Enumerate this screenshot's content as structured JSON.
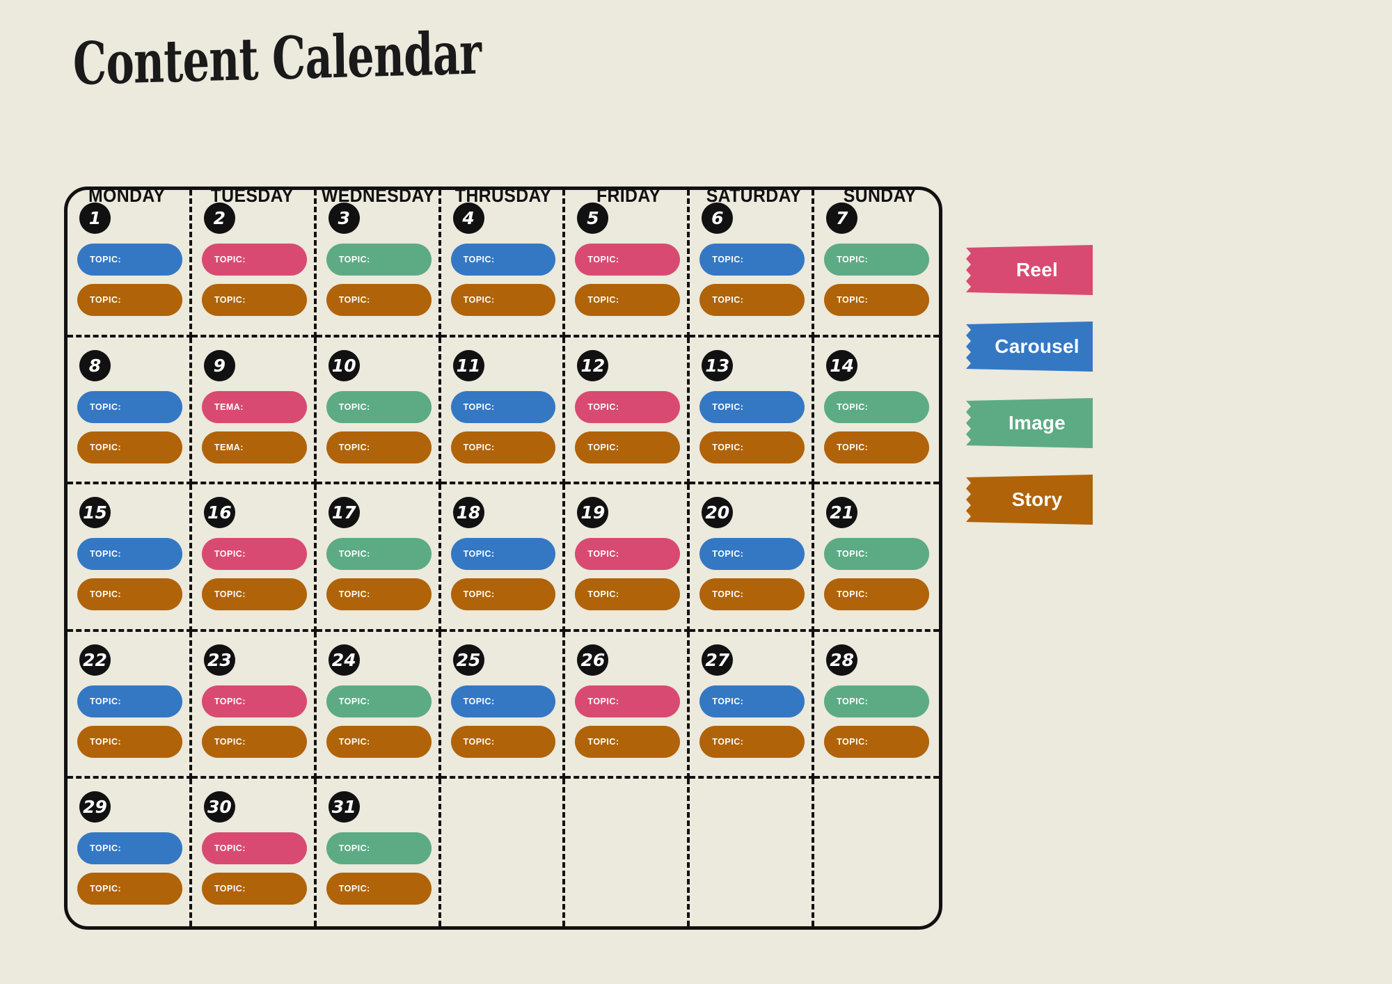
{
  "page": {
    "title": "Content Calendar",
    "background_color": "#ece9dd"
  },
  "weekdays": [
    "MONDAY",
    "TUESDAY",
    "WEDNESDAY",
    "THRUSDAY",
    "FRIDAY",
    "SATURDAY",
    "SUNDAY"
  ],
  "legend": {
    "items": [
      {
        "label": "Reel",
        "color": "#d94a72",
        "type": "reel"
      },
      {
        "label": "Carousel",
        "color": "#3478c4",
        "type": "carousel"
      },
      {
        "label": "Image",
        "color": "#5cab85",
        "type": "image"
      },
      {
        "label": "Story",
        "color": "#b06308",
        "type": "story"
      }
    ]
  },
  "calendar": {
    "weeks": [
      [
        {
          "day": "1",
          "pills": [
            {
              "label": "TOPIC:",
              "type": "carousel"
            },
            {
              "label": "TOPIC:",
              "type": "story"
            }
          ]
        },
        {
          "day": "2",
          "pills": [
            {
              "label": "TOPIC:",
              "type": "reel"
            },
            {
              "label": "TOPIC:",
              "type": "story"
            }
          ]
        },
        {
          "day": "3",
          "pills": [
            {
              "label": "TOPIC:",
              "type": "image"
            },
            {
              "label": "TOPIC:",
              "type": "story"
            }
          ]
        },
        {
          "day": "4",
          "pills": [
            {
              "label": "TOPIC:",
              "type": "carousel"
            },
            {
              "label": "TOPIC:",
              "type": "story"
            }
          ]
        },
        {
          "day": "5",
          "pills": [
            {
              "label": "TOPIC:",
              "type": "reel"
            },
            {
              "label": "TOPIC:",
              "type": "story"
            }
          ]
        },
        {
          "day": "6",
          "pills": [
            {
              "label": "TOPIC:",
              "type": "carousel"
            },
            {
              "label": "TOPIC:",
              "type": "story"
            }
          ]
        },
        {
          "day": "7",
          "pills": [
            {
              "label": "TOPIC:",
              "type": "image"
            },
            {
              "label": "TOPIC:",
              "type": "story"
            }
          ]
        }
      ],
      [
        {
          "day": "8",
          "pills": [
            {
              "label": "TOPIC:",
              "type": "carousel"
            },
            {
              "label": "TOPIC:",
              "type": "story"
            }
          ]
        },
        {
          "day": "9",
          "pills": [
            {
              "label": "TEMA:",
              "type": "reel"
            },
            {
              "label": "TEMA:",
              "type": "story"
            }
          ]
        },
        {
          "day": "10",
          "pills": [
            {
              "label": "TOPIC:",
              "type": "image"
            },
            {
              "label": "TOPIC:",
              "type": "story"
            }
          ]
        },
        {
          "day": "11",
          "pills": [
            {
              "label": "TOPIC:",
              "type": "carousel"
            },
            {
              "label": "TOPIC:",
              "type": "story"
            }
          ]
        },
        {
          "day": "12",
          "pills": [
            {
              "label": "TOPIC:",
              "type": "reel"
            },
            {
              "label": "TOPIC:",
              "type": "story"
            }
          ]
        },
        {
          "day": "13",
          "pills": [
            {
              "label": "TOPIC:",
              "type": "carousel"
            },
            {
              "label": "TOPIC:",
              "type": "story"
            }
          ]
        },
        {
          "day": "14",
          "pills": [
            {
              "label": "TOPIC:",
              "type": "image"
            },
            {
              "label": "TOPIC:",
              "type": "story"
            }
          ]
        }
      ],
      [
        {
          "day": "15",
          "pills": [
            {
              "label": "TOPIC:",
              "type": "carousel"
            },
            {
              "label": "TOPIC:",
              "type": "story"
            }
          ]
        },
        {
          "day": "16",
          "pills": [
            {
              "label": "TOPIC:",
              "type": "reel"
            },
            {
              "label": "TOPIC:",
              "type": "story"
            }
          ]
        },
        {
          "day": "17",
          "pills": [
            {
              "label": "TOPIC:",
              "type": "image"
            },
            {
              "label": "TOPIC:",
              "type": "story"
            }
          ]
        },
        {
          "day": "18",
          "pills": [
            {
              "label": "TOPIC:",
              "type": "carousel"
            },
            {
              "label": "TOPIC:",
              "type": "story"
            }
          ]
        },
        {
          "day": "19",
          "pills": [
            {
              "label": "TOPIC:",
              "type": "reel"
            },
            {
              "label": "TOPIC:",
              "type": "story"
            }
          ]
        },
        {
          "day": "20",
          "pills": [
            {
              "label": "TOPIC:",
              "type": "carousel"
            },
            {
              "label": "TOPIC:",
              "type": "story"
            }
          ]
        },
        {
          "day": "21",
          "pills": [
            {
              "label": "TOPIC:",
              "type": "image"
            },
            {
              "label": "TOPIC:",
              "type": "story"
            }
          ]
        }
      ],
      [
        {
          "day": "22",
          "pills": [
            {
              "label": "TOPIC:",
              "type": "carousel"
            },
            {
              "label": "TOPIC:",
              "type": "story"
            }
          ]
        },
        {
          "day": "23",
          "pills": [
            {
              "label": "TOPIC:",
              "type": "reel"
            },
            {
              "label": "TOPIC:",
              "type": "story"
            }
          ]
        },
        {
          "day": "24",
          "pills": [
            {
              "label": "TOPIC:",
              "type": "image"
            },
            {
              "label": "TOPIC:",
              "type": "story"
            }
          ]
        },
        {
          "day": "25",
          "pills": [
            {
              "label": "TOPIC:",
              "type": "carousel"
            },
            {
              "label": "TOPIC:",
              "type": "story"
            }
          ]
        },
        {
          "day": "26",
          "pills": [
            {
              "label": "TOPIC:",
              "type": "reel"
            },
            {
              "label": "TOPIC:",
              "type": "story"
            }
          ]
        },
        {
          "day": "27",
          "pills": [
            {
              "label": "TOPIC:",
              "type": "carousel"
            },
            {
              "label": "TOPIC:",
              "type": "story"
            }
          ]
        },
        {
          "day": "28",
          "pills": [
            {
              "label": "TOPIC:",
              "type": "image"
            },
            {
              "label": "TOPIC:",
              "type": "story"
            }
          ]
        }
      ],
      [
        {
          "day": "29",
          "pills": [
            {
              "label": "TOPIC:",
              "type": "carousel"
            },
            {
              "label": "TOPIC:",
              "type": "story"
            }
          ]
        },
        {
          "day": "30",
          "pills": [
            {
              "label": "TOPIC:",
              "type": "reel"
            },
            {
              "label": "TOPIC:",
              "type": "story"
            }
          ]
        },
        {
          "day": "31",
          "pills": [
            {
              "label": "TOPIC:",
              "type": "image"
            },
            {
              "label": "TOPIC:",
              "type": "story"
            }
          ]
        },
        {
          "day": "",
          "pills": []
        },
        {
          "day": "",
          "pills": []
        },
        {
          "day": "",
          "pills": []
        },
        {
          "day": "",
          "pills": []
        }
      ]
    ]
  }
}
